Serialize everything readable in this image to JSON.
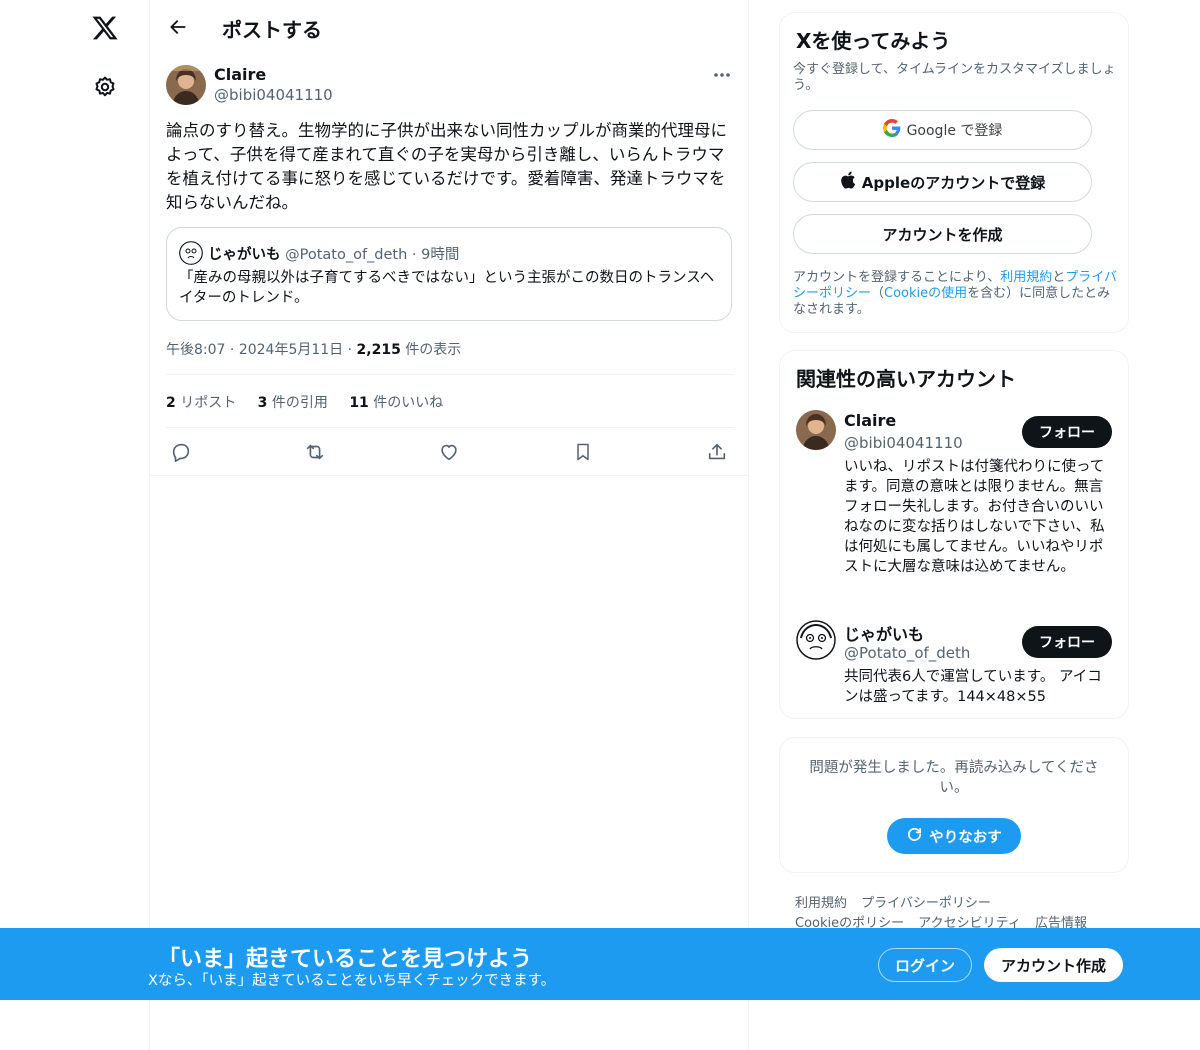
{
  "nav": {
    "logo_icon": "x-logo-icon",
    "settings_icon": "gear-icon"
  },
  "header": {
    "title": "ポストする"
  },
  "post": {
    "author_name": "Claire",
    "author_handle": "@bibi04041110",
    "text": "論点のすり替え。生物学的に子供が出来ない同性カップルが商業的代理母によって、子供を得て産まれて直ぐの子を実母から引き離し、いらんトラウマを植え付けてる事に怒りを感じているだけです。愛着障害、発達トラウマを知らないんだね。",
    "quote": {
      "name": "じゃがいも",
      "handle": "@Potato_of_deth",
      "dot": "·",
      "time": "9時間",
      "text": "「産みの母親以外は子育てするべきではない」という主張がこの数日のトランスヘイターのトレンド。"
    },
    "time": "午後8:07",
    "date": "2024年5月11日",
    "sep": "·",
    "views_count": "2,215",
    "views_label": "件の表示",
    "stats": [
      {
        "count": "2",
        "label": "リポスト"
      },
      {
        "count": "3",
        "label": "件の引用"
      },
      {
        "count": "11",
        "label": "件のいいね"
      }
    ],
    "actions": [
      "reply-icon",
      "repost-icon",
      "like-icon",
      "bookmark-icon",
      "share-icon"
    ]
  },
  "signup_card": {
    "title": "Xを使ってみよう",
    "subtitle": "今すぐ登録して、タイムラインをカスタマイズしましょう。",
    "google_label": "Google で登録",
    "apple_label": "Appleのアカウントで登録",
    "create_label": "アカウントを作成",
    "legal_prefix": "アカウントを登録することにより、",
    "legal_terms": "利用規約",
    "legal_and": "と",
    "legal_privacy": "プライバシーポリシー",
    "legal_open": "（",
    "legal_cookie": "Cookieの使用",
    "legal_suffix": "を含む）に同意したとみなされます。"
  },
  "relevant": {
    "title": "関連性の高いアカウント",
    "follow_label": "フォロー",
    "accounts": [
      {
        "name": "Claire",
        "handle": "@bibi04041110",
        "bio": "いいね、リポストは付箋代わりに使ってます。同意の意味とは限りません。無言フォロー失礼します。お付き合いのいいねなのに変な括りはしないで下さい、私は何処にも属してません。いいねやリポストに大層な意味は込めてません。"
      },
      {
        "name": "じゃがいも",
        "handle": "@Potato_of_deth",
        "bio": "共同代表6人で運営しています。 アイコンは盛ってます。144×48×55"
      }
    ]
  },
  "error_card": {
    "message": "問題が発生しました。再読み込みしてください。",
    "retry_label": "やりなおす"
  },
  "footer": {
    "row1": [
      "利用規約",
      "プライバシーポリシー"
    ],
    "row2": [
      "Cookieのポリシー",
      "アクセシビリティ",
      "広告情報"
    ]
  },
  "bottom_bar": {
    "title": "「いま」起きていることを見つけよう",
    "subtitle": "Xなら、「いま」起きていることをいち早くチェックできます。",
    "login_label": "ログイン",
    "signup_label": "アカウント作成"
  },
  "colors": {
    "accent": "#1d9bf0",
    "text": "#0f1419",
    "secondary": "#536471",
    "border": "#eff3f4"
  }
}
